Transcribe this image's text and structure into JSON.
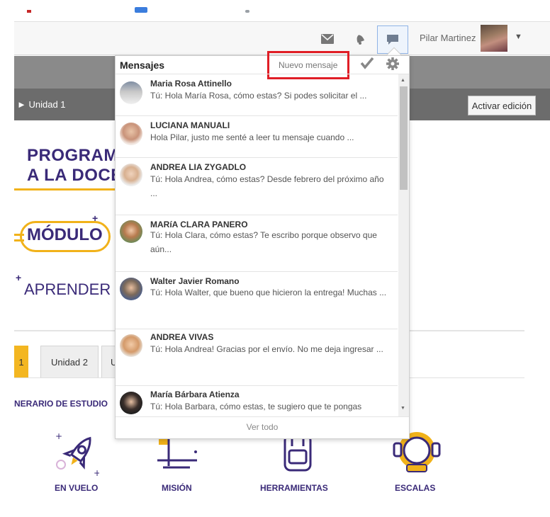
{
  "navbar": {
    "user_name": "Pilar Martinez",
    "icons": [
      "mail-icon",
      "bell-icon",
      "chat-icon"
    ]
  },
  "course": {
    "section_label": "► Unidad 1",
    "edit_button": "Activar edición",
    "banner_line1": "PROGRAMA",
    "banner_line2": "A LA DOCE",
    "modulo": "MÓDULO",
    "aprender": "APRENDER E",
    "tabs": [
      "1",
      "Unidad 2",
      "U"
    ],
    "itinerario": "NERARIO DE ESTUDIO",
    "bottom_labels": [
      "EN VUELO",
      "MISIÓN",
      "HERRAMIENTAS",
      "ESCALAS"
    ]
  },
  "messages": {
    "title": "Mensajes",
    "new_message": "Nuevo mensaje",
    "footer": "Ver todo",
    "items": [
      {
        "name": "Maria Rosa Attinello",
        "text": "Tú: Hola María Rosa, cómo estas? Si podes solicitar el ..."
      },
      {
        "name": "LUCIANA MANUALI",
        "text": "Hola Pilar, justo me senté a leer tu mensaje cuando ..."
      },
      {
        "name": "ANDREA LIA ZYGADLO",
        "text": "Tú: Hola Andrea, cómo estas? Desde febrero del próximo año ..."
      },
      {
        "name": "MARíA CLARA PANERO",
        "text": "Tú: Hola Clara, cómo estas? Te escribo porque observo que aún..."
      },
      {
        "name": "Walter Javier Romano",
        "text": "Tú: Hola Walter, que bueno que hicieron la entrega! Muchas ..."
      },
      {
        "name": "ANDREA VIVAS",
        "text": "Tú: Hola Andrea! Gracias por el envío. No me deja ingresar ..."
      },
      {
        "name": "María Bárbara Atienza",
        "text": "Tú: Hola Barbara, cómo estas, te sugiero que te pongas"
      }
    ]
  },
  "colors": {
    "brand_purple": "#3a2a78",
    "brand_yellow": "#f1b21a",
    "highlight_red": "#e01e26"
  }
}
